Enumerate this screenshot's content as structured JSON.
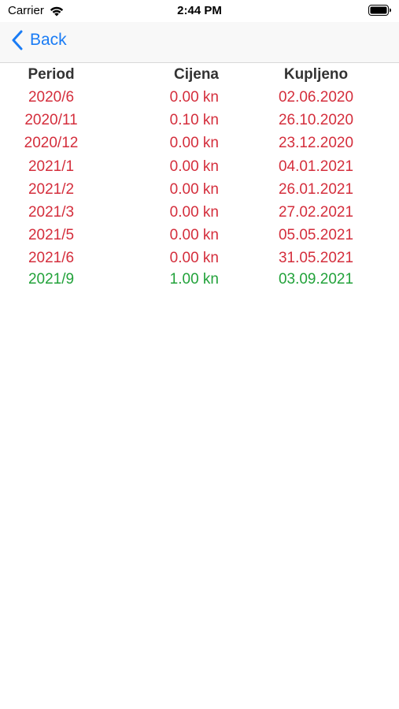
{
  "status_bar": {
    "carrier": "Carrier",
    "time": "2:44 PM",
    "wifi_icon": "wifi-icon",
    "battery_icon": "battery-icon"
  },
  "nav": {
    "back_label": "Back",
    "back_icon": "chevron-left-icon",
    "accent_color": "#1a7cf5"
  },
  "table": {
    "headers": {
      "period": "Period",
      "price": "Cijena",
      "purchased": "Kupljeno"
    },
    "rows": [
      {
        "period": "2020/6",
        "price": "0.00 kn",
        "purchased": "02.06.2020",
        "status": "red"
      },
      {
        "period": "2020/11",
        "price": "0.10 kn",
        "purchased": "26.10.2020",
        "status": "red"
      },
      {
        "period": "2020/12",
        "price": "0.00 kn",
        "purchased": "23.12.2020",
        "status": "red"
      },
      {
        "period": "2021/1",
        "price": "0.00 kn",
        "purchased": "04.01.2021",
        "status": "red"
      },
      {
        "period": "2021/2",
        "price": "0.00 kn",
        "purchased": "26.01.2021",
        "status": "red"
      },
      {
        "period": "2021/3",
        "price": "0.00 kn",
        "purchased": "27.02.2021",
        "status": "red"
      },
      {
        "period": "2021/5",
        "price": "0.00 kn",
        "purchased": "05.05.2021",
        "status": "red"
      },
      {
        "period": "2021/6",
        "price": "0.00 kn",
        "purchased": "31.05.2021",
        "status": "red"
      },
      {
        "period": "2021/9",
        "price": "1.00 kn",
        "purchased": "03.09.2021",
        "status": "green"
      }
    ],
    "colors": {
      "red": "#d42e3c",
      "green": "#22a23a",
      "header": "#333333"
    }
  }
}
